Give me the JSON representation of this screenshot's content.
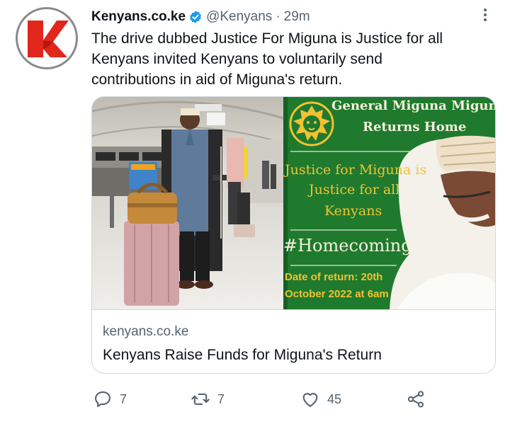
{
  "account": {
    "display_name": "Kenyans.co.ke",
    "handle": "@Kenyans",
    "separator": "·",
    "time": "29m",
    "avatar_icon": "kenyans-k-logo",
    "verified_icon": "verified-badge-icon"
  },
  "tweet": {
    "lines": [
      "The drive dubbed Justice For Miguna is Justice for all",
      "Kenyans invited Kenyans to voluntarily send",
      "contributions in aid of Miguna's return."
    ]
  },
  "card": {
    "poster": {
      "header_line1": "General Miguna Migun",
      "header_line2": "Returns Home",
      "slogan_line1": "Justice for Miguna is",
      "slogan_line2": "Justice for all",
      "slogan_line3": "Kenyans",
      "hashtag": "#Homecoming",
      "date_line1": "Date of return: 20th",
      "date_line2": "October 2022 at 6am"
    },
    "domain": "kenyans.co.ke",
    "title": "Kenyans Raise Funds for Miguna's Return"
  },
  "actions": {
    "reply_count": "7",
    "retweet_count": "7",
    "like_count": "45"
  },
  "colors": {
    "brand_red": "#e1261c",
    "verified_blue": "#1d9bf0",
    "poster_green": "#1f7a2e",
    "poster_gold": "#f2c230",
    "poster_cream": "#f5f0dc",
    "text_secondary": "#536471"
  }
}
